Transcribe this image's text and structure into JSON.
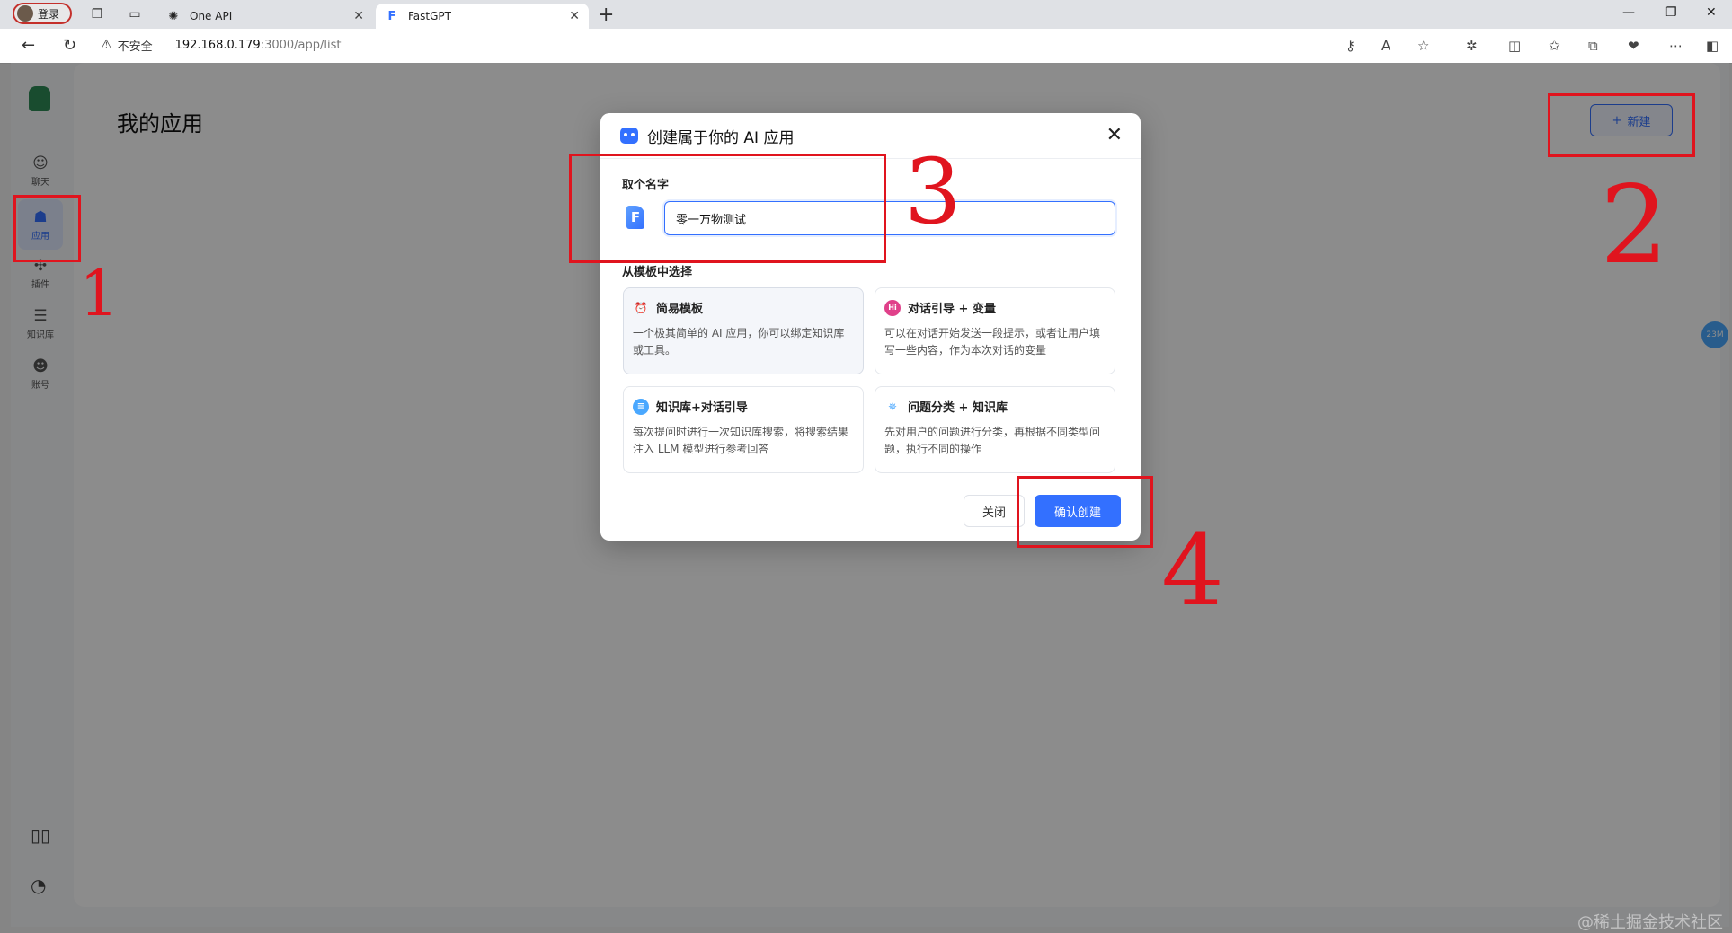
{
  "browser": {
    "profile_label": "登录",
    "tabs": [
      {
        "title": "One API"
      },
      {
        "title": "FastGPT"
      }
    ],
    "security_label": "不安全",
    "url_host": "192.168.0.179",
    "url_path": ":3000/app/list"
  },
  "sidebar": {
    "items": [
      {
        "label": "聊天",
        "icon": "chat-icon"
      },
      {
        "label": "应用",
        "icon": "robot-icon"
      },
      {
        "label": "插件",
        "icon": "puzzle-icon"
      },
      {
        "label": "知识库",
        "icon": "database-icon"
      },
      {
        "label": "账号",
        "icon": "user-icon"
      }
    ]
  },
  "main": {
    "title": "我的应用",
    "new_button": "新建"
  },
  "float_badge": "23M",
  "modal": {
    "title": "创建属于你的 AI 应用",
    "name_label": "取个名字",
    "name_value": "零一万物测试",
    "template_label": "从模板中选择",
    "templates": [
      {
        "title": "简易模板",
        "desc": "一个极其简单的 AI 应用，你可以绑定知识库或工具。"
      },
      {
        "title": "对话引导 + 变量",
        "desc": "可以在对话开始发送一段提示，或者让用户填写一些内容，作为本次对话的变量"
      },
      {
        "title": "知识库+对话引导",
        "desc": "每次提问时进行一次知识库搜索，将搜索结果注入 LLM 模型进行参考回答"
      },
      {
        "title": "问题分类 + 知识库",
        "desc": "先对用户的问题进行分类，再根据不同类型问题，执行不同的操作"
      }
    ],
    "close_button": "关闭",
    "confirm_button": "确认创建"
  },
  "annotations": {
    "numbers": [
      "1",
      "2",
      "3",
      "4"
    ],
    "color": "#e0141e"
  },
  "watermark": "@稀土掘金技术社区",
  "colors": {
    "accent": "#3370ff",
    "annotation": "#e0141e"
  }
}
